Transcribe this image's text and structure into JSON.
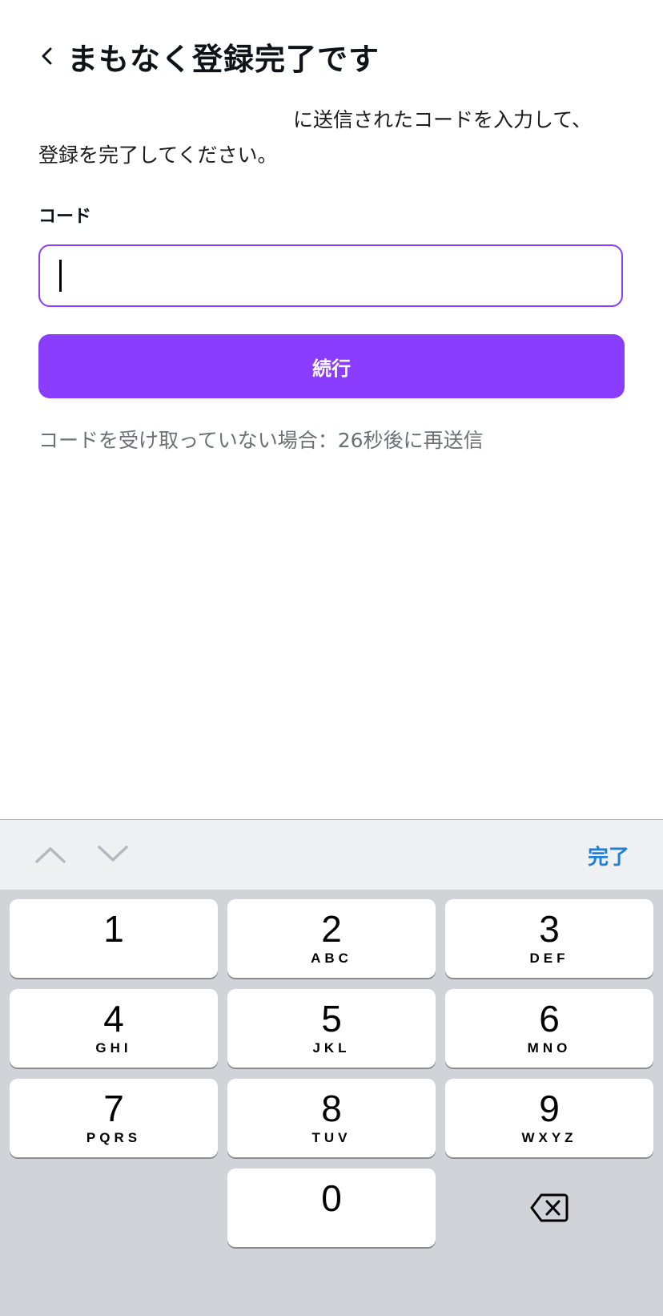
{
  "header": {
    "title": "まもなく登録完了です"
  },
  "instructions": {
    "line1": "に送信されたコードを入力して、",
    "line2": "登録を完了してください。"
  },
  "form": {
    "code_label": "コード",
    "code_value": "",
    "continue_label": "続行",
    "resend_text": "コードを受け取っていない場合：26秒後に再送信"
  },
  "colors": {
    "accent": "#8b3dff",
    "done_blue": "#1f7ed8"
  },
  "keyboard": {
    "done_label": "完了",
    "keys": [
      {
        "num": "1",
        "letters": ""
      },
      {
        "num": "2",
        "letters": "ABC"
      },
      {
        "num": "3",
        "letters": "DEF"
      },
      {
        "num": "4",
        "letters": "GHI"
      },
      {
        "num": "5",
        "letters": "JKL"
      },
      {
        "num": "6",
        "letters": "MNO"
      },
      {
        "num": "7",
        "letters": "PQRS"
      },
      {
        "num": "8",
        "letters": "TUV"
      },
      {
        "num": "9",
        "letters": "WXYZ"
      },
      {
        "num": "0",
        "letters": ""
      }
    ],
    "icons": [
      "chevron-up-icon",
      "chevron-down-icon",
      "backspace-icon"
    ]
  }
}
